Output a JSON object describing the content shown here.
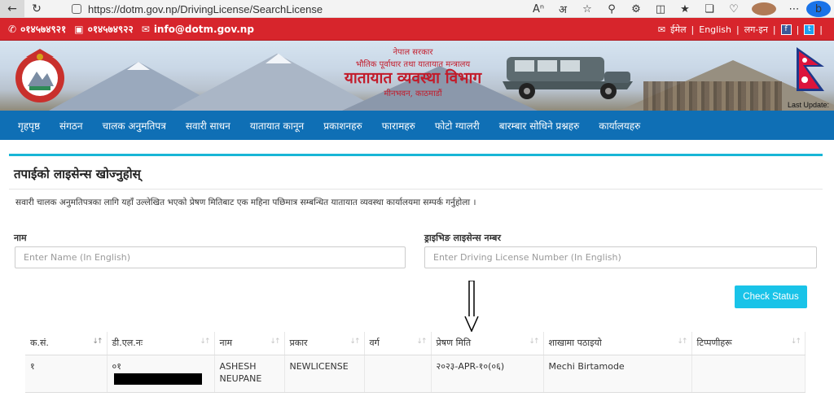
{
  "browser": {
    "url": "https://dotm.gov.np/DrivingLicense/SearchLicense"
  },
  "topbar": {
    "phone1": "०१४५७४९२१",
    "phone2": "०१४५७४९२२",
    "email": "info@dotm.gov.np",
    "email_label": "ईमेल",
    "lang": "English",
    "login": "लग-इन"
  },
  "banner": {
    "line1": "नेपाल सरकार",
    "line2": "भौतिक पूर्वाधार तथा यातायात मन्त्रालय",
    "line3": "यातायात व्यवस्था विभाग",
    "line4": "मीनभवन, काठमाडौं",
    "last_update": "Last Update:"
  },
  "nav": [
    "गृहपृष्ठ",
    "संगठन",
    "चालक अनुमतिपत्र",
    "सवारी साधन",
    "यातायात कानून",
    "प्रकाशनहरु",
    "फारामहरु",
    "फोटो ग्यालरी",
    "बारम्बार सोधिने प्रश्नहरु",
    "कार्यालयहरु"
  ],
  "page": {
    "title": "तपाईको लाइसेन्स खोज्नुहोस्",
    "notice": "सवारी चालक अनुमतिपत्रका लागि यहाँ उल्लेखित भएको प्रेषण मितिबाट एक महिना पछिमात्र सम्बन्धित यातायात व्यवस्था कार्यालयमा सम्पर्क गर्नुहोला ।",
    "name_label": "नाम",
    "name_placeholder": "Enter Name (In English)",
    "license_label": "ड्राइभिङ लाइसेन्स नम्बर",
    "license_placeholder": "Enter Driving License Number (In English)",
    "check_button": "Check Status"
  },
  "table": {
    "headers": [
      "क.सं.",
      "डी.एल.नः",
      "नाम",
      "प्रकार",
      "वर्ग",
      "प्रेषण मिति",
      "शाखामा पठाइयो",
      "टिप्पणीहरू"
    ],
    "rows": [
      {
        "sn": "१",
        "dl_prefix": "०१",
        "name": "ASHESH NEUPANE",
        "type": "NEWLICENSE",
        "category": "",
        "dispatch_date": "२०२३-APR-१०(०६)",
        "branch": "Mechi Birtamode",
        "remarks": ""
      }
    ]
  }
}
